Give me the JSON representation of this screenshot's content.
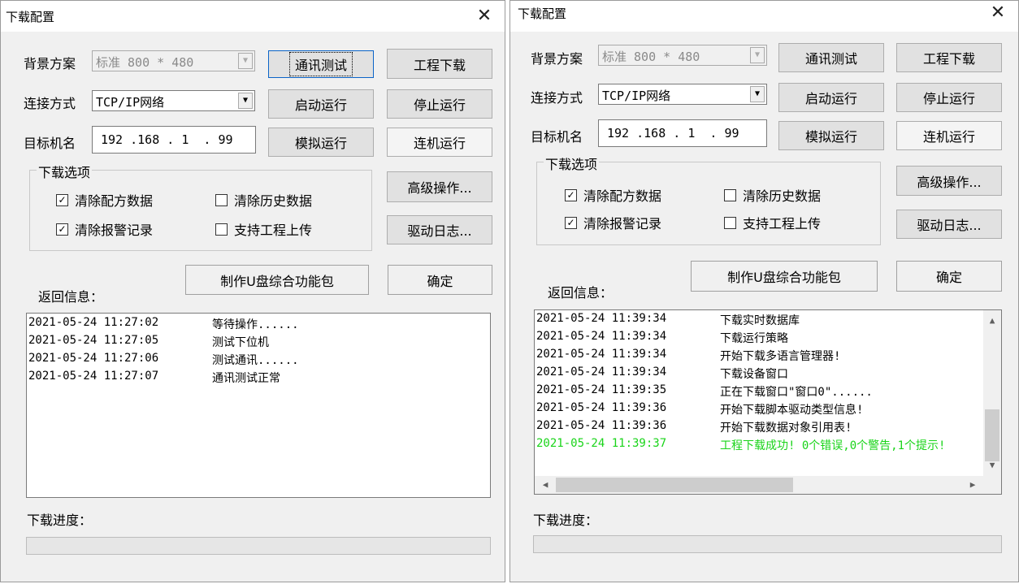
{
  "dialog1": {
    "title": "下载配置",
    "close": "✕",
    "scheme_label": "背景方案",
    "scheme_value": "标准 800 * 480",
    "conn_label": "连接方式",
    "conn_value": "TCP/IP网络",
    "target_label": "目标机名",
    "target_value": "192 .168 . 1  . 99",
    "buttons": {
      "comm_test": "通讯测试",
      "project_download": "工程下载",
      "start_run": "启动运行",
      "stop_run": "停止运行",
      "simulate_run": "模拟运行",
      "online_run": "连机运行",
      "advanced": "高级操作...",
      "driver_log": "驱动日志...",
      "make_usb": "制作U盘综合功能包",
      "ok": "确定"
    },
    "options_label": "下载选项",
    "options": [
      {
        "label": "清除配方数据",
        "checked": true
      },
      {
        "label": "清除历史数据",
        "checked": false
      },
      {
        "label": "清除报警记录",
        "checked": true
      },
      {
        "label": "支持工程上传",
        "checked": false
      }
    ],
    "return_info_label": "返回信息：",
    "log": [
      {
        "time": "2021-05-24 11:27:02",
        "msg": "等待操作......"
      },
      {
        "time": "2021-05-24 11:27:05",
        "msg": "测试下位机"
      },
      {
        "time": "2021-05-24 11:27:06",
        "msg": "测试通讯......"
      },
      {
        "time": "2021-05-24 11:27:07",
        "msg": "通讯测试正常"
      }
    ],
    "progress_label": "下载进度：",
    "progress": 0
  },
  "dialog2": {
    "title": "下载配置",
    "close": "✕",
    "scheme_label": "背景方案",
    "scheme_value": "标准 800 * 480",
    "conn_label": "连接方式",
    "conn_value": "TCP/IP网络",
    "target_label": "目标机名",
    "target_value": "192 .168 . 1  . 99",
    "buttons": {
      "comm_test": "通讯测试",
      "project_download": "工程下载",
      "start_run": "启动运行",
      "stop_run": "停止运行",
      "simulate_run": "模拟运行",
      "online_run": "连机运行",
      "advanced": "高级操作...",
      "driver_log": "驱动日志...",
      "make_usb": "制作U盘综合功能包",
      "ok": "确定"
    },
    "options_label": "下载选项",
    "options": [
      {
        "label": "清除配方数据",
        "checked": true
      },
      {
        "label": "清除历史数据",
        "checked": false
      },
      {
        "label": "清除报警记录",
        "checked": true
      },
      {
        "label": "支持工程上传",
        "checked": false
      }
    ],
    "return_info_label": "返回信息：",
    "log": [
      {
        "time": "2021-05-24 11:39:34",
        "msg": "下载实时数据库"
      },
      {
        "time": "2021-05-24 11:39:34",
        "msg": "下载运行策略"
      },
      {
        "time": "2021-05-24 11:39:34",
        "msg": "开始下载多语言管理器!"
      },
      {
        "time": "2021-05-24 11:39:34",
        "msg": "下载设备窗口"
      },
      {
        "time": "2021-05-24 11:39:35",
        "msg": "正在下载窗口\"窗口0\"......"
      },
      {
        "time": "2021-05-24 11:39:36",
        "msg": "开始下载脚本驱动类型信息!"
      },
      {
        "time": "2021-05-24 11:39:36",
        "msg": "开始下载数据对象引用表!"
      },
      {
        "time": "2021-05-24 11:39:37",
        "msg": "工程下载成功! 0个错误,0个警告,1个提示!",
        "color": "#19d419"
      }
    ],
    "scroll_up": "▲",
    "scroll_down": "▼",
    "scroll_left": "◀",
    "scroll_right": "▶",
    "progress_label": "下载进度：",
    "progress": 0
  }
}
